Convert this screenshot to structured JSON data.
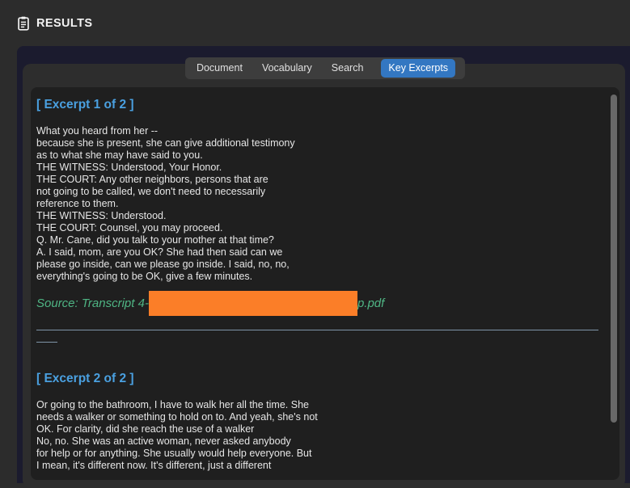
{
  "header": {
    "title": "RESULTS",
    "icon": "clipboard-icon"
  },
  "tabs": {
    "items": [
      {
        "label": "Document",
        "active": false
      },
      {
        "label": "Vocabulary",
        "active": false
      },
      {
        "label": "Search",
        "active": false
      },
      {
        "label": "Key Excerpts",
        "active": true
      }
    ]
  },
  "excerpts": [
    {
      "heading": "[ Excerpt 1 of 2 ]",
      "body": "What you heard from her --\nbecause she is present, she can give additional testimony\nas to what she may have said to you.\nTHE WITNESS: Understood, Your Honor.\nTHE COURT: Any other neighbors, persons that are\nnot going to be called, we don't need to necessarily\nreference to them.\nTHE WITNESS: Understood.\nTHE COURT: Counsel, you may proceed.\nQ. Mr. Cane, did you talk to your mother at that time?\nA. I said, mom, are you OK? She had then said can we\nplease go inside, can we please go inside. I said, no, no,\neverything's going to be OK, give a few minutes.",
      "source": {
        "prefix": "Source: Transcript 4-",
        "redacted": true,
        "suffix": "p.pdf"
      }
    },
    {
      "heading": "[ Excerpt 2 of 2 ]",
      "body": "Or going to the bathroom, I have to walk her all the time. She\nneeds a walker or something to hold on to. And yeah, she's not\nOK. For clarity, did she reach the use of a walker\nNo, no. She was an active woman, never asked anybody\nfor help or for anything. She usually would help everyone. But\nI mean, it's different now. It's different, just a different"
    }
  ],
  "colors": {
    "active_tab_blue": "#3377c2",
    "heading_blue": "#4aa0e0",
    "source_green": "#4fb584",
    "redaction_orange": "#fb7e28",
    "divider_slate": "#7f94a8",
    "panel_navy": "#1b1b2e",
    "content_dark": "#1f1f1f"
  }
}
